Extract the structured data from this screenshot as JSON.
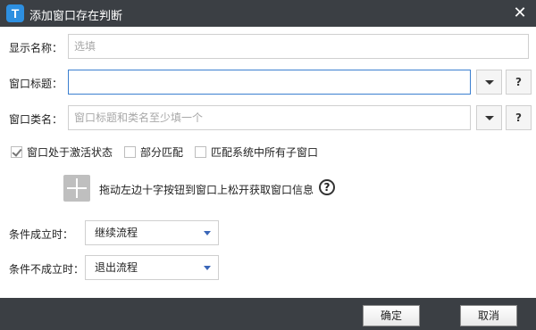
{
  "window": {
    "title": "添加窗口存在判断",
    "app_icon_letter": "T",
    "close_glyph": "✕"
  },
  "display_name": {
    "label": "显示名称：",
    "value": "",
    "placeholder": "选填"
  },
  "window_title": {
    "label": "窗口标题：",
    "value": "",
    "placeholder": "",
    "help": "?"
  },
  "window_class": {
    "label": "窗口类名：",
    "value": "",
    "placeholder": "窗口标题和类名至少填一个",
    "help": "?"
  },
  "options": {
    "active_state": {
      "label": "窗口处于激活状态",
      "checked": true
    },
    "partial_match": {
      "label": "部分匹配",
      "checked": false
    },
    "match_all_children": {
      "label": "匹配系统中所有子窗口",
      "checked": false
    }
  },
  "picker": {
    "instruction": "拖动左边十字按钮到窗口上松开获取窗口信息",
    "help": "?"
  },
  "condition_true": {
    "label": "条件成立时：",
    "selected": "继续流程"
  },
  "condition_false": {
    "label": "条件不成立时：",
    "selected": "退出流程"
  },
  "footer": {
    "ok_label": "确定",
    "cancel_label": "取消"
  },
  "colors": {
    "titlebar": "#3b3f44",
    "accent": "#3b7fd0",
    "dropdown_arrow": "#3a66b8"
  }
}
